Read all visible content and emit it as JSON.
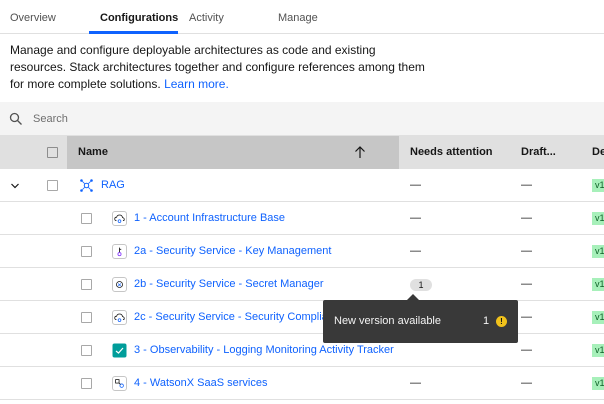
{
  "tabs": [
    {
      "label": "Overview"
    },
    {
      "label": "Configurations",
      "active": true
    },
    {
      "label": "Activity"
    },
    {
      "label": "Manage"
    }
  ],
  "description": {
    "text": "Manage and configure deployable architectures as code and existing resources. Stack architectures together and configure references among them for more complete solutions.",
    "link": "Learn more."
  },
  "search": {
    "placeholder": "Search",
    "icon": "search-icon"
  },
  "table": {
    "headers": {
      "name": "Name",
      "needs_attention": "Needs attention",
      "draft": "Draft...",
      "next": "De"
    },
    "sort_icon": "arrow-up-icon",
    "rows": [
      {
        "name": "RAG",
        "needs_attention": "—",
        "draft": "—",
        "version": "v1",
        "icon": "stack-icon",
        "expanded": true
      },
      {
        "name": "1 - Account Infrastructure Base",
        "needs_attention": "—",
        "draft": "—",
        "version": "v1",
        "icon": "cloud-gear-icon"
      },
      {
        "name": "2a - Security Service - Key Management",
        "needs_attention": "—",
        "draft": "—",
        "version": "v1",
        "icon": "key-icon"
      },
      {
        "name": "2b - Security Service - Secret Manager",
        "needs_attention": "1",
        "draft": "—",
        "version": "v1",
        "icon": "secret-icon"
      },
      {
        "name": "2c - Security Service - Security Compliance",
        "needs_attention": "",
        "draft": "—",
        "version": "v1",
        "icon": "cloud-gear-icon"
      },
      {
        "name": "3 - Observability - Logging Monitoring Activity Tracker",
        "needs_attention": "",
        "draft": "—",
        "version": "v1",
        "icon": "observability-icon"
      },
      {
        "name": "4 - WatsonX SaaS services",
        "needs_attention": "—",
        "draft": "—",
        "version": "v1",
        "icon": "services-icon"
      }
    ]
  },
  "tooltip": {
    "message": "New version available",
    "count": "1",
    "warn_glyph": "!"
  },
  "colors": {
    "link": "#0f62fe",
    "version_bg": "#a7f0ba",
    "warning": "#f1c21b",
    "tooltip_bg": "#393939"
  }
}
